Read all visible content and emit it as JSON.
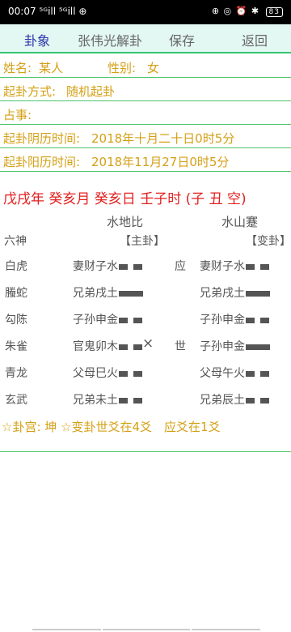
{
  "status": {
    "time": "00:07",
    "signal": "⁵ᴳill ⁵ᴳill ⊕",
    "icons": "⊕ ◎ ⏰ ✱",
    "battery": "83"
  },
  "toolbar": {
    "tabs": [
      "卦象",
      "张伟光解卦",
      "保存",
      "返回"
    ]
  },
  "info": {
    "name_label": "姓名:",
    "name_value": "某人",
    "gender_label": "性别:",
    "gender_value": "女",
    "method_label": "起卦方式:",
    "method_value": "随机起卦",
    "matter_label": "占事:",
    "lunar_label": "起卦阴历时间:",
    "lunar_value": "2018年十月二十日0时5分",
    "solar_label": "起卦阳历时间:",
    "solar_value": "2018年11月27日0时5分"
  },
  "ganzhi": "戊戌年 癸亥月 癸亥日 壬子时 (子 丑 空)",
  "main_name": "水地比",
  "changed_name": "水山蹇",
  "liushen_header": "六神",
  "main_tag": "【主卦】",
  "changed_tag": "【变卦】",
  "rows": [
    {
      "god": "白虎",
      "main": "妻财子水",
      "main_yin": true,
      "marker": "应",
      "changed": "妻财子水",
      "changed_yin": true,
      "moving": ""
    },
    {
      "god": "螣蛇",
      "main": "兄弟戌土",
      "main_yin": false,
      "marker": "",
      "changed": "兄弟戌土",
      "changed_yin": false,
      "moving": ""
    },
    {
      "god": "勾陈",
      "main": "子孙申金",
      "main_yin": true,
      "marker": "",
      "changed": "子孙申金",
      "changed_yin": true,
      "moving": ""
    },
    {
      "god": "朱雀",
      "main": "官鬼卯木",
      "main_yin": true,
      "marker": "世",
      "changed": "子孙申金",
      "changed_yin": false,
      "moving": "×"
    },
    {
      "god": "青龙",
      "main": "父母巳火",
      "main_yin": true,
      "marker": "",
      "changed": "父母午火",
      "changed_yin": true,
      "moving": ""
    },
    {
      "god": "玄武",
      "main": "兄弟未土",
      "main_yin": true,
      "marker": "",
      "changed": "兄弟辰土",
      "changed_yin": true,
      "moving": ""
    }
  ],
  "summary": "☆卦宫: 坤 ☆变卦世爻在4爻　应爻在1爻"
}
